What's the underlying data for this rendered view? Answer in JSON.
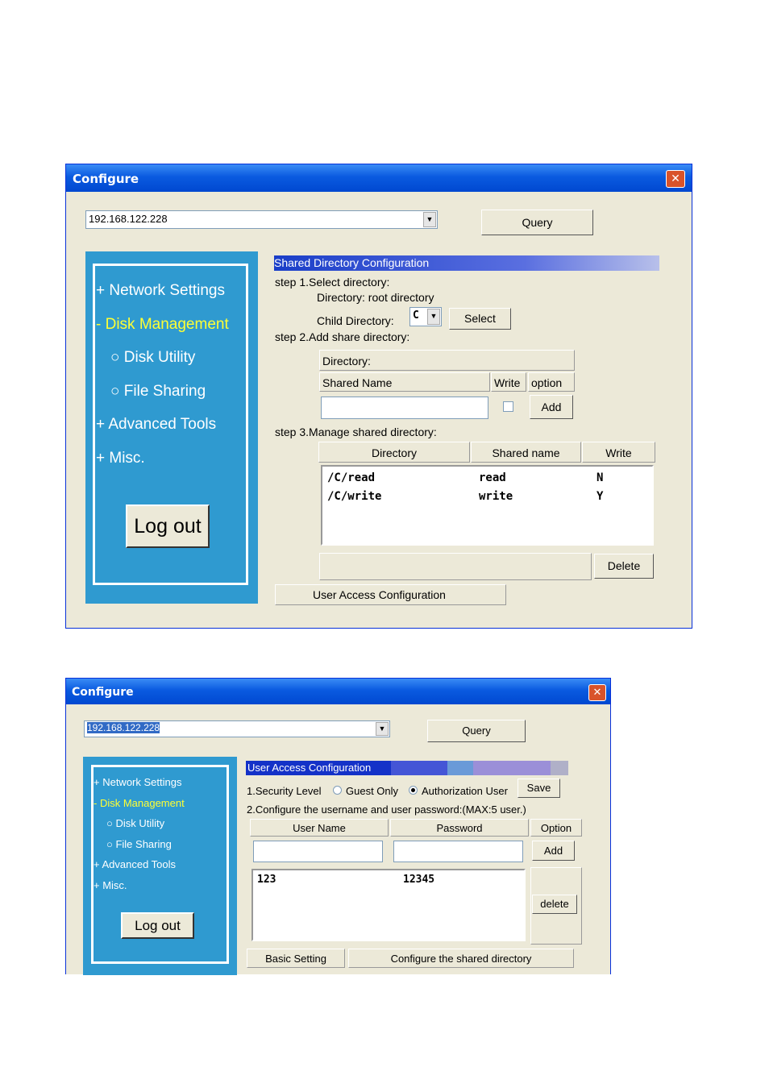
{
  "window1": {
    "title": "Configure",
    "close": "✕",
    "ip_value": "192.168.122.228",
    "query_label": "Query",
    "nav": [
      "+ Network Settings",
      "- Disk Management",
      "Disk Utility",
      "File Sharing",
      "+ Advanced Tools",
      "+ Misc."
    ],
    "logout_label": "Log out",
    "panel_title": "Shared Directory Configuration",
    "step1": "step 1.Select directory:",
    "dir_root": "Directory: root directory",
    "child_dir_label": "Child Directory:",
    "child_dir_value": "C",
    "select_label": "Select",
    "step2": "step 2.Add share directory:",
    "directory_label": "Directory:",
    "shared_name_header": "Shared Name",
    "write_header": "Write",
    "option_header": "option",
    "add_label": "Add",
    "step3": "step 3.Manage shared directory:",
    "table_headers": [
      "Directory",
      "Shared name",
      "Write"
    ],
    "rows": [
      {
        "dir": "/C/read",
        "name": "read",
        "write": "N"
      },
      {
        "dir": "/C/write",
        "name": "write",
        "write": "Y"
      }
    ],
    "delete_label": "Delete",
    "bottom_tab": "User Access Configuration"
  },
  "window2": {
    "title": "Configure",
    "close": "✕",
    "ip_value": "192.168.122.228",
    "query_label": "Query",
    "nav": [
      "+ Network Settings",
      "- Disk Management",
      "Disk Utility",
      "File Sharing",
      "+ Advanced Tools",
      "+ Misc."
    ],
    "logout_label": "Log out",
    "panel_title": "User Access Configuration",
    "security_label": "1.Security Level",
    "guest_only": "Guest Only",
    "auth_user": "Authorization User",
    "security_selected": "Authorization User",
    "save_label": "Save",
    "config_text": "2.Configure the username and user password:(MAX:5 user.)",
    "headers": [
      "User Name",
      "Password",
      "Option"
    ],
    "add_label": "Add",
    "rows": [
      {
        "user": "123",
        "password": "12345"
      }
    ],
    "delete_label": "delete",
    "tab_basic": "Basic Setting",
    "tab_shared": "Configure the shared directory"
  }
}
